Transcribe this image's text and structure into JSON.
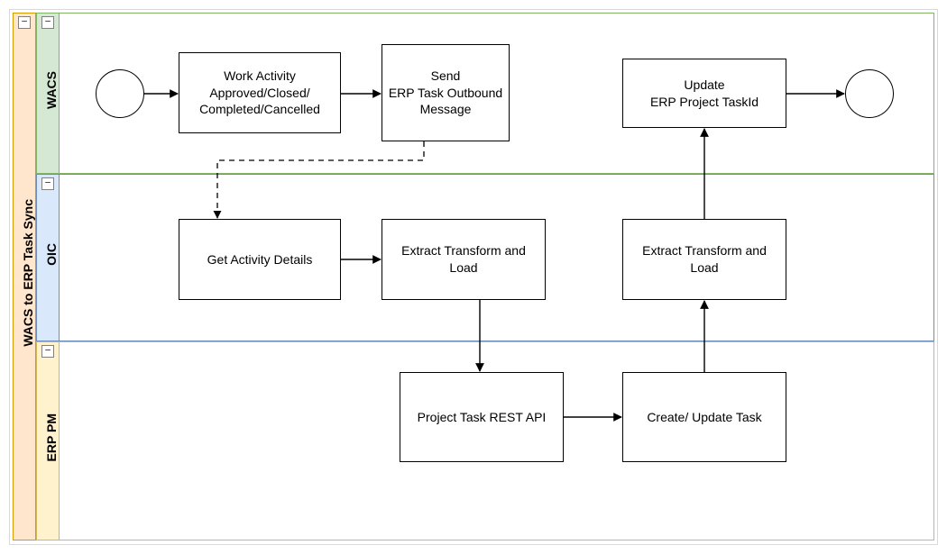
{
  "title": "WACS to ERP Task Sync",
  "lanes": {
    "wacs": {
      "label": "WACS"
    },
    "oic": {
      "label": "OIC"
    },
    "erppm": {
      "label": "ERP PM"
    }
  },
  "nodes": {
    "start": {
      "label": ""
    },
    "work_activity": {
      "label": "Work Activity Approved/Closed/ Completed/Cancelled"
    },
    "send_erp_task": {
      "label": "Send\nERP Task Outbound Message"
    },
    "update_erp_taskid": {
      "label": "Update\nERP Project TaskId"
    },
    "end": {
      "label": ""
    },
    "get_activity": {
      "label": "Get Activity Details"
    },
    "etl1": {
      "label": "Extract Transform and Load"
    },
    "etl2": {
      "label": "Extract Transform and Load"
    },
    "rest_api": {
      "label": "Project Task REST API"
    },
    "create_update": {
      "label": "Create/ Update Task"
    }
  },
  "icons": {
    "collapse": "−"
  }
}
